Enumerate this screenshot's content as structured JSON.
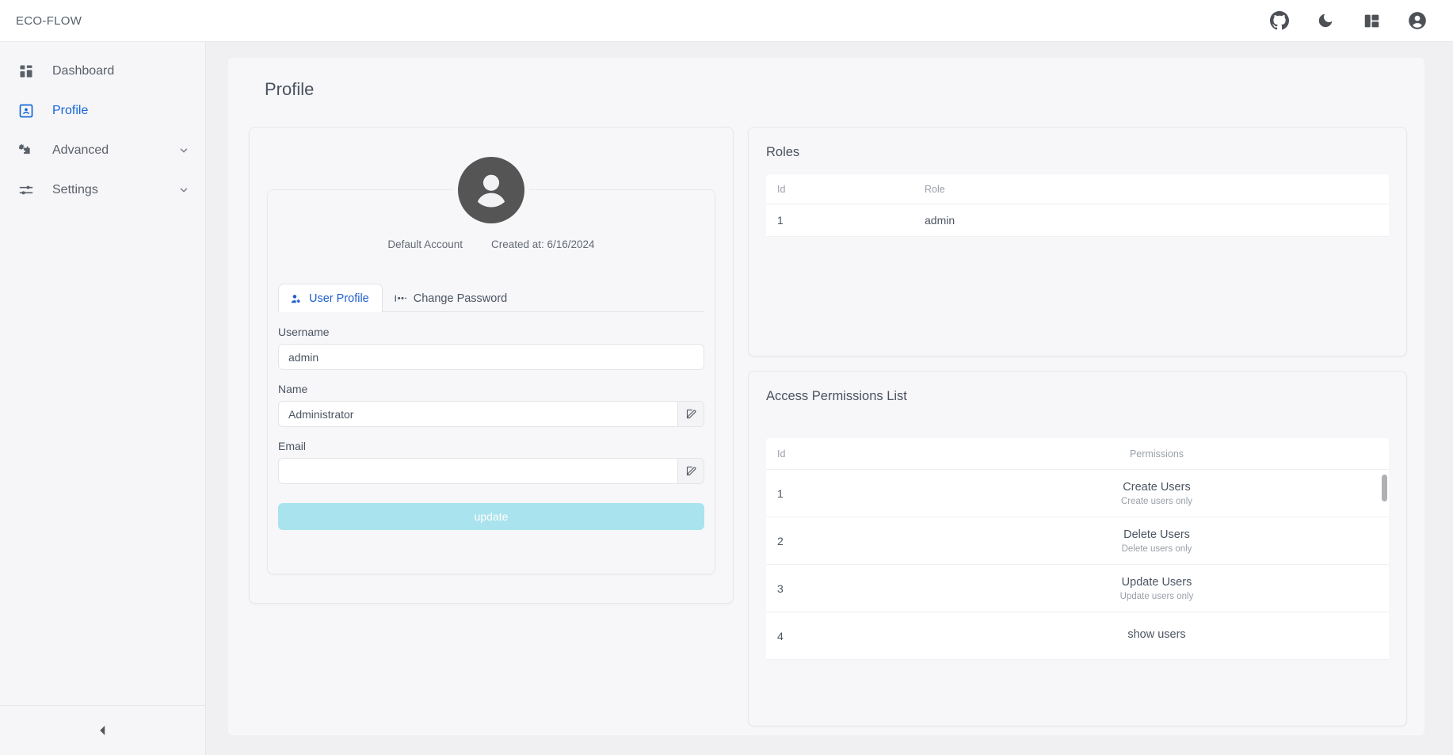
{
  "app": {
    "brand": "ECO-FLOW"
  },
  "topbar": {
    "icons": [
      {
        "name": "github-icon",
        "label": "GitHub"
      },
      {
        "name": "moon-icon",
        "label": "Dark mode"
      },
      {
        "name": "layout-icon",
        "label": "Layout"
      },
      {
        "name": "account-icon",
        "label": "Account"
      }
    ]
  },
  "sidebar": {
    "items": [
      {
        "label": "Dashboard",
        "icon": "dashboard-icon",
        "active": false,
        "expandable": false
      },
      {
        "label": "Profile",
        "icon": "profile-icon",
        "active": true,
        "expandable": false
      },
      {
        "label": "Advanced",
        "icon": "advanced-icon",
        "active": false,
        "expandable": true
      },
      {
        "label": "Settings",
        "icon": "settings-icon",
        "active": false,
        "expandable": true
      }
    ],
    "collapse_label": "Collapse sidebar"
  },
  "page": {
    "title": "Profile"
  },
  "profile": {
    "account_type": "Default Account",
    "created_at": "Created at: 6/16/2024",
    "tabs": [
      {
        "label": "User Profile",
        "icon": "user-gear-icon",
        "active": true
      },
      {
        "label": "Change Password",
        "icon": "password-icon",
        "active": false
      }
    ],
    "fields": [
      {
        "label": "Username",
        "value": "admin",
        "placeholder": "",
        "editable": false
      },
      {
        "label": "Name",
        "value": "Administrator",
        "placeholder": "",
        "editable": true
      },
      {
        "label": "Email",
        "value": "",
        "placeholder": "",
        "editable": true
      }
    ],
    "update_label": "update"
  },
  "roles": {
    "title": "Roles",
    "columns": [
      "Id",
      "Role"
    ],
    "rows": [
      {
        "id": "1",
        "role": "admin"
      }
    ]
  },
  "permissions": {
    "title": "Access Permissions List",
    "columns": [
      "Id",
      "Permissions"
    ],
    "rows": [
      {
        "id": "1",
        "name": "Create Users",
        "desc": "Create users only"
      },
      {
        "id": "2",
        "name": "Delete Users",
        "desc": "Delete users only"
      },
      {
        "id": "3",
        "name": "Update Users",
        "desc": "Update users only"
      },
      {
        "id": "4",
        "name": "show users",
        "desc": ""
      }
    ]
  },
  "colors": {
    "accent": "#1565d8",
    "update_button": "#a9e3ed",
    "avatar": "#555555"
  }
}
